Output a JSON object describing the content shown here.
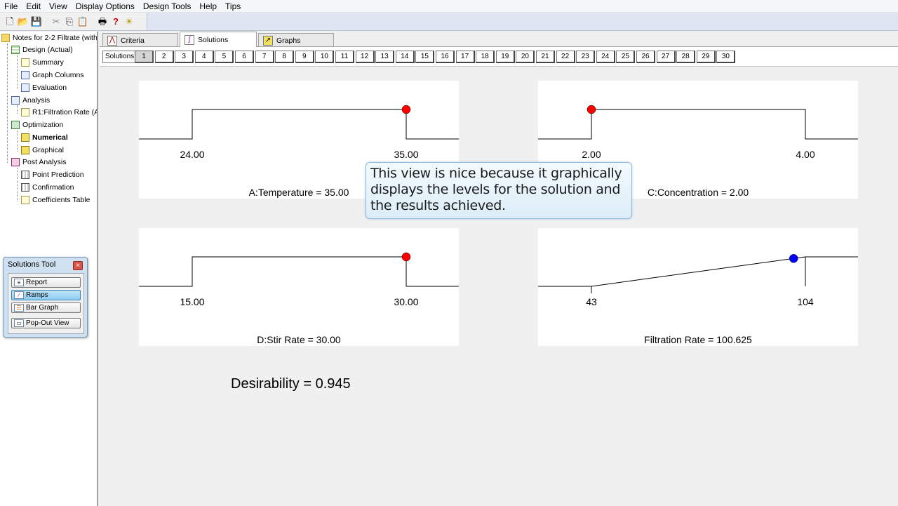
{
  "menu": [
    "File",
    "Edit",
    "View",
    "Display Options",
    "Design Tools",
    "Help",
    "Tips"
  ],
  "tree": {
    "root": "Notes for 2-2 Filtrate (with",
    "design": "Design (Actual)",
    "summary": "Summary",
    "graph_columns": "Graph Columns",
    "evaluation": "Evaluation",
    "analysis": "Analysis",
    "r1": "R1:Filtration Rate (A",
    "optimization": "Optimization",
    "numerical": "Numerical",
    "graphical": "Graphical",
    "post_analysis": "Post Analysis",
    "point_prediction": "Point Prediction",
    "confirmation": "Confirmation",
    "coefficients_table": "Coefficients Table"
  },
  "tabs": [
    "Criteria",
    "Solutions",
    "Graphs"
  ],
  "solutions_label": "Solutions",
  "solutions": [
    "1",
    "2",
    "3",
    "4",
    "5",
    "6",
    "7",
    "8",
    "9",
    "10",
    "11",
    "12",
    "13",
    "14",
    "15",
    "16",
    "17",
    "18",
    "19",
    "20",
    "21",
    "22",
    "23",
    "24",
    "25",
    "26",
    "27",
    "28",
    "29",
    "30"
  ],
  "selected_solution": "1",
  "ramps": [
    {
      "title": "A:Temperature = 35.00",
      "low": "24.00",
      "high": "35.00",
      "value_fraction": 1.0,
      "dot_color": "#ff0000",
      "shape": "step"
    },
    {
      "title": "C:Concentration = 2.00",
      "low": "2.00",
      "high": "4.00",
      "value_fraction": 0.0,
      "dot_color": "#ff0000",
      "shape": "step"
    },
    {
      "title": "D:Stir Rate = 30.00",
      "low": "15.00",
      "high": "30.00",
      "value_fraction": 1.0,
      "dot_color": "#ff0000",
      "shape": "step"
    },
    {
      "title": "Filtration Rate = 100.625",
      "low": "43",
      "high": "104",
      "value_fraction": 0.945,
      "dot_color": "#0000ff",
      "shape": "ramp"
    }
  ],
  "desirability": "Desirability = 0.945",
  "callout": "This view is nice because it graphically displays the levels for the solution and the results achieved.",
  "solutions_tool": {
    "title": "Solutions Tool",
    "buttons": [
      "Report",
      "Ramps",
      "Bar Graph",
      "Pop-Out View"
    ],
    "active": "Ramps"
  }
}
